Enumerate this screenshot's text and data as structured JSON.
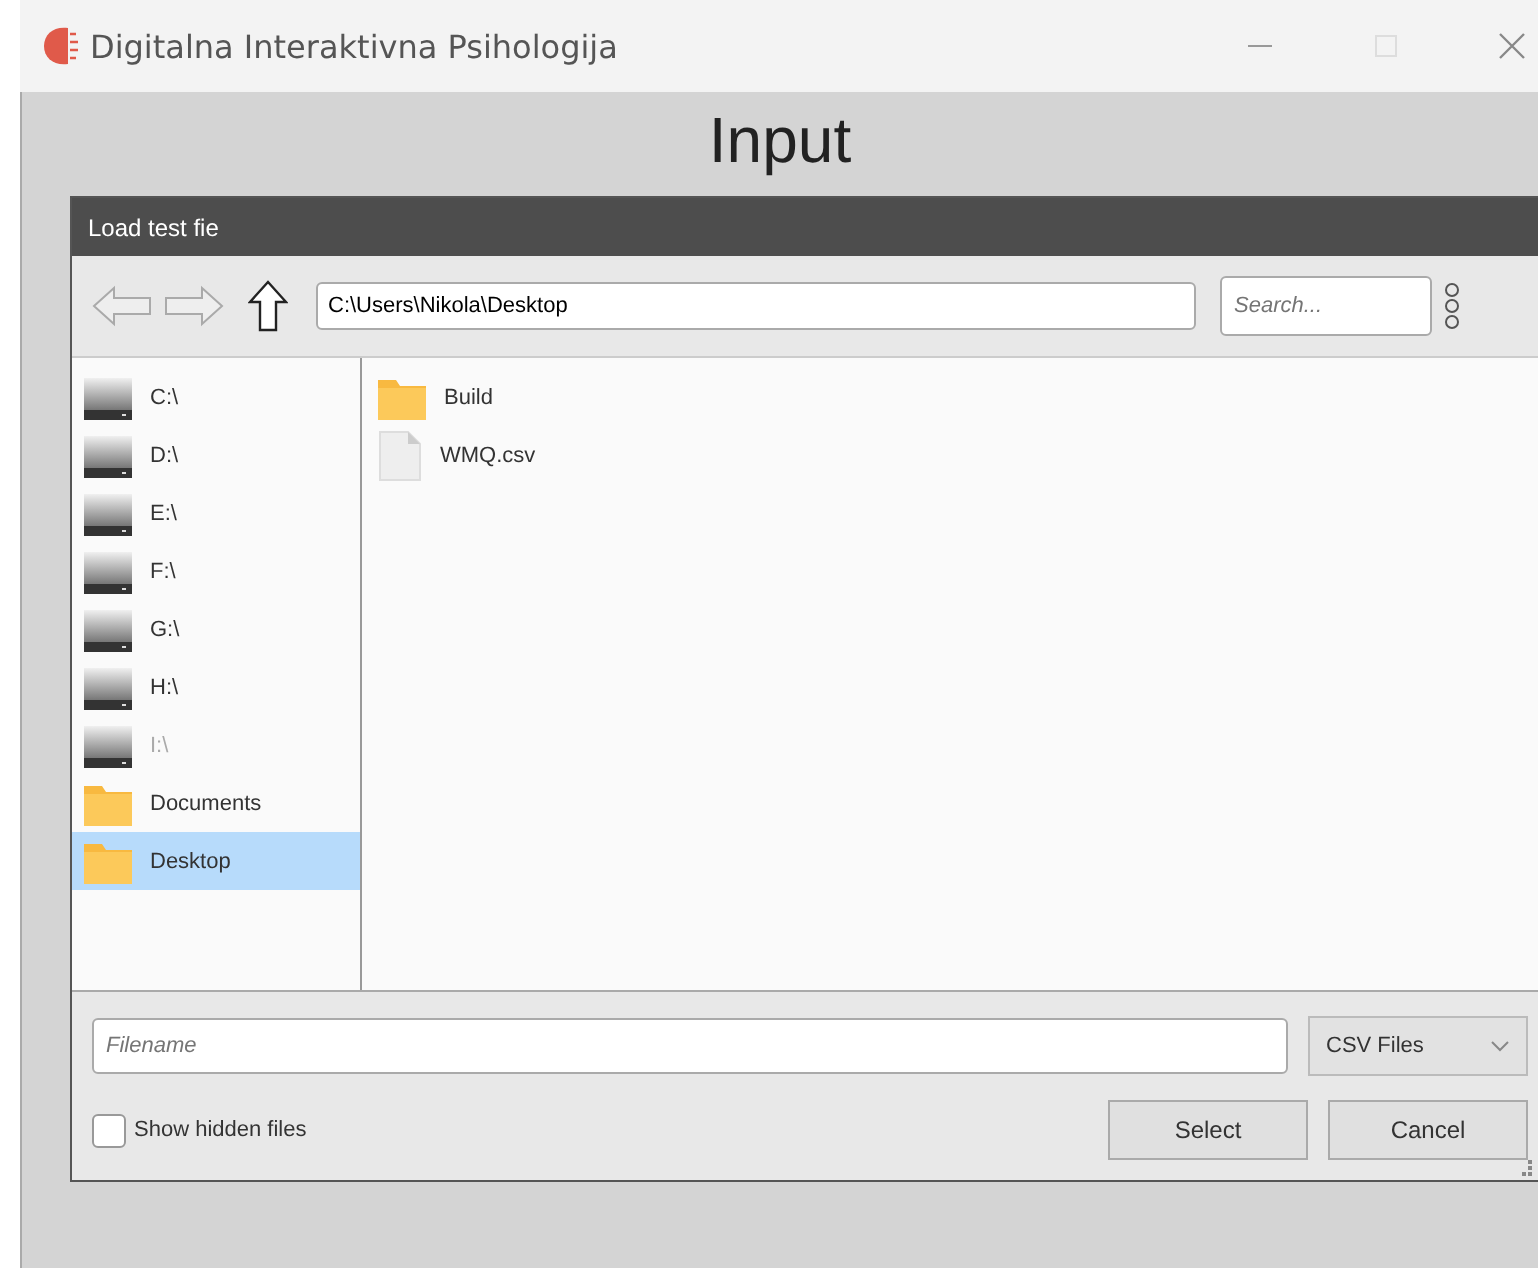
{
  "window": {
    "title": "Digitalna Interaktivna Psihologija"
  },
  "heading": "Input",
  "dialog": {
    "title": "Load test fie",
    "path": "C:\\Users\\Nikola\\Desktop",
    "search": {
      "placeholder": "Search..."
    },
    "sidebar": [
      {
        "label": "C:\\",
        "kind": "drive",
        "selected": false,
        "disabled": false
      },
      {
        "label": "D:\\",
        "kind": "drive",
        "selected": false,
        "disabled": false
      },
      {
        "label": "E:\\",
        "kind": "drive",
        "selected": false,
        "disabled": false
      },
      {
        "label": "F:\\",
        "kind": "drive",
        "selected": false,
        "disabled": false
      },
      {
        "label": "G:\\",
        "kind": "drive",
        "selected": false,
        "disabled": false
      },
      {
        "label": "H:\\",
        "kind": "drive",
        "selected": false,
        "disabled": false
      },
      {
        "label": "I:\\",
        "kind": "drive",
        "selected": false,
        "disabled": true
      },
      {
        "label": "Documents",
        "kind": "folder",
        "selected": false,
        "disabled": false
      },
      {
        "label": "Desktop",
        "kind": "folder",
        "selected": true,
        "disabled": false
      }
    ],
    "files": [
      {
        "name": "Build",
        "kind": "folder"
      },
      {
        "name": "WMQ.csv",
        "kind": "file"
      }
    ],
    "filename": {
      "placeholder": "Filename"
    },
    "filter": "CSV Files",
    "show_hidden": {
      "label": "Show hidden files",
      "checked": false
    },
    "buttons": [
      "Select",
      "Cancel"
    ]
  }
}
